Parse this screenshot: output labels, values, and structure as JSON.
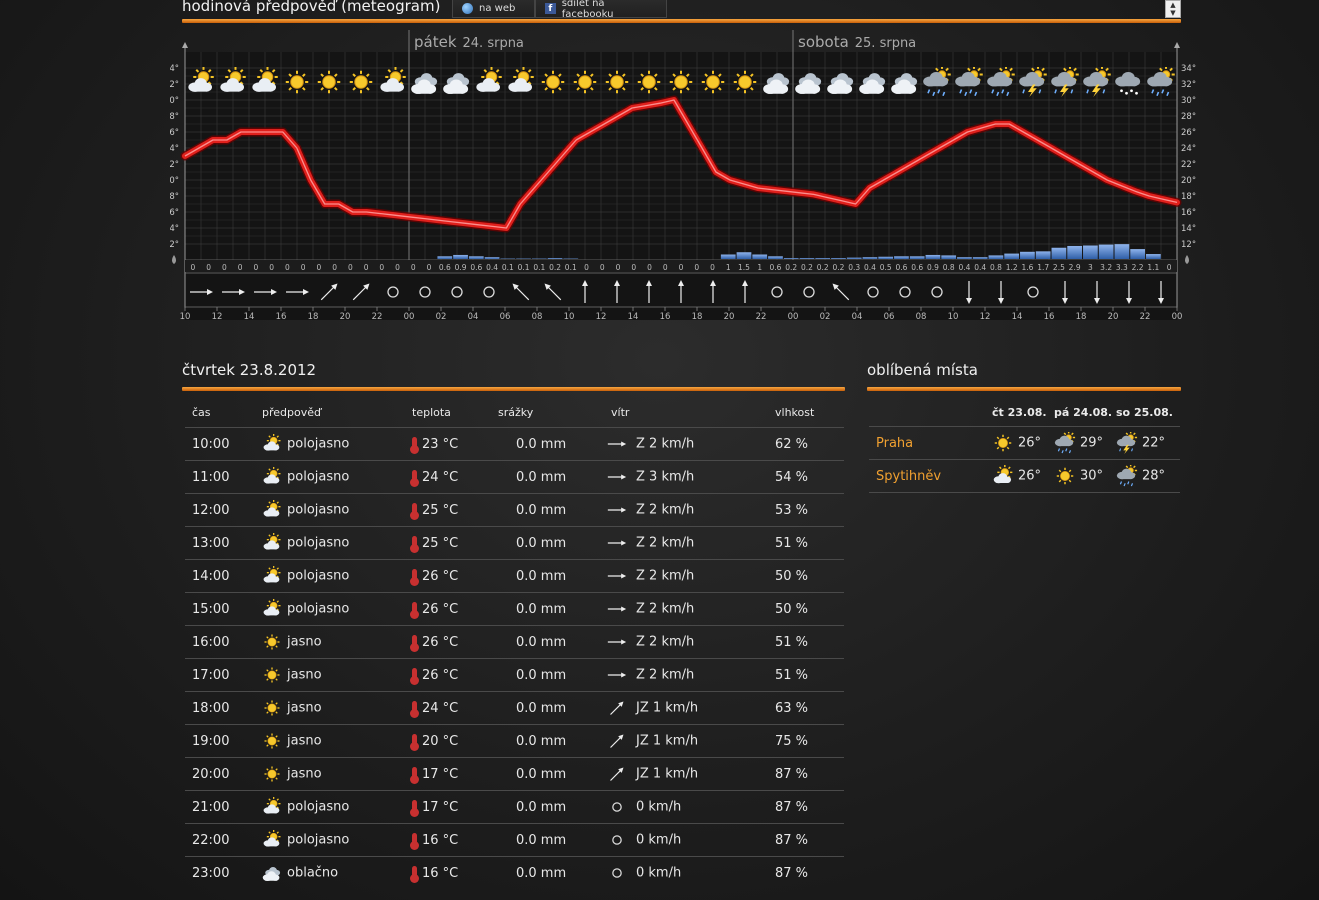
{
  "header": {
    "title": "hodinová předpověď (meteogram)",
    "share_web": "na web",
    "share_facebook": "sdílet na facebooku"
  },
  "meteogram": {
    "days": [
      {
        "name": "pátek",
        "date": "24. srpna"
      },
      {
        "name": "sobota",
        "date": "25. srpna"
      }
    ],
    "y_ticks": [
      "12°",
      "14°",
      "16°",
      "18°",
      "20°",
      "22°",
      "24°",
      "26°",
      "28°",
      "30°",
      "32°",
      "34°"
    ],
    "x_ticks": [
      "10",
      "12",
      "14",
      "16",
      "18",
      "20",
      "22",
      "00",
      "02",
      "04",
      "06",
      "08",
      "10",
      "12",
      "14",
      "16",
      "18",
      "20",
      "22",
      "00",
      "02",
      "04",
      "06",
      "08",
      "10",
      "12",
      "14",
      "16",
      "18",
      "20",
      "22",
      "00"
    ],
    "icons": [
      "partly-cloudy-icon",
      "partly-cloudy-icon",
      "partly-cloudy-icon",
      "sun-icon",
      "sun-icon",
      "sun-icon",
      "partly-cloudy-icon",
      "cloudy-icon",
      "cloudy-icon",
      "partly-cloudy-icon",
      "partly-cloudy-icon",
      "sun-icon",
      "sun-icon",
      "sun-icon",
      "sun-icon",
      "sun-icon",
      "sun-icon",
      "sun-icon",
      "cloudy-icon",
      "cloudy-icon",
      "cloudy-icon",
      "cloudy-icon",
      "cloudy-icon",
      "rain-icon",
      "rain-icon",
      "rain-icon",
      "storm-icon",
      "storm-icon",
      "storm-icon",
      "snow-icon",
      "rain-icon"
    ],
    "temperature": [
      23,
      24,
      25,
      25,
      26,
      26,
      26,
      26,
      24,
      20,
      17,
      17,
      16,
      16,
      15.8,
      15.6,
      15.4,
      15.2,
      15,
      14.8,
      14.6,
      14.4,
      14.2,
      14,
      17,
      19,
      21,
      23,
      25,
      26,
      27,
      28,
      29,
      29.3,
      29.6,
      30,
      27,
      24,
      21,
      20,
      19.5,
      19,
      18.8,
      18.6,
      18.4,
      18.2,
      17.8,
      17.4,
      17,
      19,
      20,
      21,
      22,
      23,
      24,
      25,
      26,
      26.5,
      27,
      27,
      26,
      25,
      24,
      23,
      22,
      21,
      20,
      19.3,
      18.6,
      18,
      17.6,
      17.2
    ],
    "precipitation": [
      "0",
      "0",
      "0",
      "0",
      "0",
      "0",
      "0",
      "0",
      "0",
      "0",
      "0",
      "0",
      "0",
      "0",
      "0",
      "0",
      "0.6",
      "0.9",
      "0.6",
      "0.4",
      "0.1",
      "0.1",
      "0.1",
      "0.2",
      "0.1",
      "0",
      "0",
      "0",
      "0",
      "0",
      "0",
      "0",
      "0",
      "0",
      "1",
      "1.5",
      "1",
      "0.6",
      "0.2",
      "0.2",
      "0.2",
      "0.2",
      "0.3",
      "0.4",
      "0.5",
      "0.6",
      "0.6",
      "0.9",
      "0.8",
      "0.4",
      "0.4",
      "0.8",
      "1.2",
      "1.6",
      "1.7",
      "2.5",
      "2.9",
      "3",
      "3.2",
      "3.3",
      "2.2",
      "1.1",
      "0"
    ],
    "wind_dirs": [
      "E",
      "E",
      "E",
      "E",
      "NE",
      "NE",
      "calm",
      "calm",
      "calm",
      "calm",
      "NW",
      "NW",
      "N",
      "N",
      "N",
      "N",
      "N",
      "N",
      "calm",
      "calm",
      "NW",
      "calm",
      "calm",
      "calm",
      "S",
      "S",
      "calm",
      "S",
      "S",
      "S",
      "S"
    ]
  },
  "hourly": {
    "heading": "čtvrtek 23.8.2012",
    "columns": [
      "čas",
      "předpověď",
      "teplota",
      "srážky",
      "vítr",
      "vlhkost"
    ],
    "rows": [
      {
        "time": "10:00",
        "icon": "partly-cloudy-icon",
        "forecast": "polojasno",
        "temp": "23 °C",
        "precip": "0.0 mm",
        "wind_dir": "E",
        "wind": "Z 2 km/h",
        "humidity": "62 %"
      },
      {
        "time": "11:00",
        "icon": "partly-cloudy-icon",
        "forecast": "polojasno",
        "temp": "24 °C",
        "precip": "0.0 mm",
        "wind_dir": "E",
        "wind": "Z 3 km/h",
        "humidity": "54 %"
      },
      {
        "time": "12:00",
        "icon": "partly-cloudy-icon",
        "forecast": "polojasno",
        "temp": "25 °C",
        "precip": "0.0 mm",
        "wind_dir": "E",
        "wind": "Z 2 km/h",
        "humidity": "53 %"
      },
      {
        "time": "13:00",
        "icon": "partly-cloudy-icon",
        "forecast": "polojasno",
        "temp": "25 °C",
        "precip": "0.0 mm",
        "wind_dir": "E",
        "wind": "Z 2 km/h",
        "humidity": "51 %"
      },
      {
        "time": "14:00",
        "icon": "partly-cloudy-icon",
        "forecast": "polojasno",
        "temp": "26 °C",
        "precip": "0.0 mm",
        "wind_dir": "E",
        "wind": "Z 2 km/h",
        "humidity": "50 %"
      },
      {
        "time": "15:00",
        "icon": "partly-cloudy-icon",
        "forecast": "polojasno",
        "temp": "26 °C",
        "precip": "0.0 mm",
        "wind_dir": "E",
        "wind": "Z 2 km/h",
        "humidity": "50 %"
      },
      {
        "time": "16:00",
        "icon": "sun-icon",
        "forecast": "jasno",
        "temp": "26 °C",
        "precip": "0.0 mm",
        "wind_dir": "E",
        "wind": "Z 2 km/h",
        "humidity": "51 %"
      },
      {
        "time": "17:00",
        "icon": "sun-icon",
        "forecast": "jasno",
        "temp": "26 °C",
        "precip": "0.0 mm",
        "wind_dir": "E",
        "wind": "Z 2 km/h",
        "humidity": "51 %"
      },
      {
        "time": "18:00",
        "icon": "sun-icon",
        "forecast": "jasno",
        "temp": "24 °C",
        "precip": "0.0 mm",
        "wind_dir": "NE",
        "wind": "JZ 1 km/h",
        "humidity": "63 %"
      },
      {
        "time": "19:00",
        "icon": "sun-icon",
        "forecast": "jasno",
        "temp": "20 °C",
        "precip": "0.0 mm",
        "wind_dir": "NE",
        "wind": "JZ 1 km/h",
        "humidity": "75 %"
      },
      {
        "time": "20:00",
        "icon": "sun-icon",
        "forecast": "jasno",
        "temp": "17 °C",
        "precip": "0.0 mm",
        "wind_dir": "NE",
        "wind": "JZ 1 km/h",
        "humidity": "87 %"
      },
      {
        "time": "21:00",
        "icon": "partly-cloudy-icon",
        "forecast": "polojasno",
        "temp": "17 °C",
        "precip": "0.0 mm",
        "wind_dir": "calm",
        "wind": "0 km/h",
        "humidity": "87 %"
      },
      {
        "time": "22:00",
        "icon": "partly-cloudy-icon",
        "forecast": "polojasno",
        "temp": "16 °C",
        "precip": "0.0 mm",
        "wind_dir": "calm",
        "wind": "0 km/h",
        "humidity": "87 %"
      },
      {
        "time": "23:00",
        "icon": "cloudy-icon",
        "forecast": "oblačno",
        "temp": "16 °C",
        "precip": "0.0 mm",
        "wind_dir": "calm",
        "wind": "0 km/h",
        "humidity": "87 %"
      }
    ]
  },
  "favorites": {
    "heading": "oblíbená místa",
    "days": [
      {
        "abbr": "čt",
        "date": "23.08."
      },
      {
        "abbr": "pá",
        "date": "24.08."
      },
      {
        "abbr": "so",
        "date": "25.08."
      }
    ],
    "places": [
      {
        "name": "Praha",
        "forecasts": [
          {
            "icon": "sun-icon",
            "temp": "26°"
          },
          {
            "icon": "rain-icon",
            "temp": "29°"
          },
          {
            "icon": "storm-icon",
            "temp": "22°"
          }
        ]
      },
      {
        "name": "Spytihněv",
        "forecasts": [
          {
            "icon": "partly-cloudy-icon",
            "temp": "26°"
          },
          {
            "icon": "sun-icon",
            "temp": "30°"
          },
          {
            "icon": "rain-icon",
            "temp": "28°"
          }
        ]
      }
    ]
  }
}
